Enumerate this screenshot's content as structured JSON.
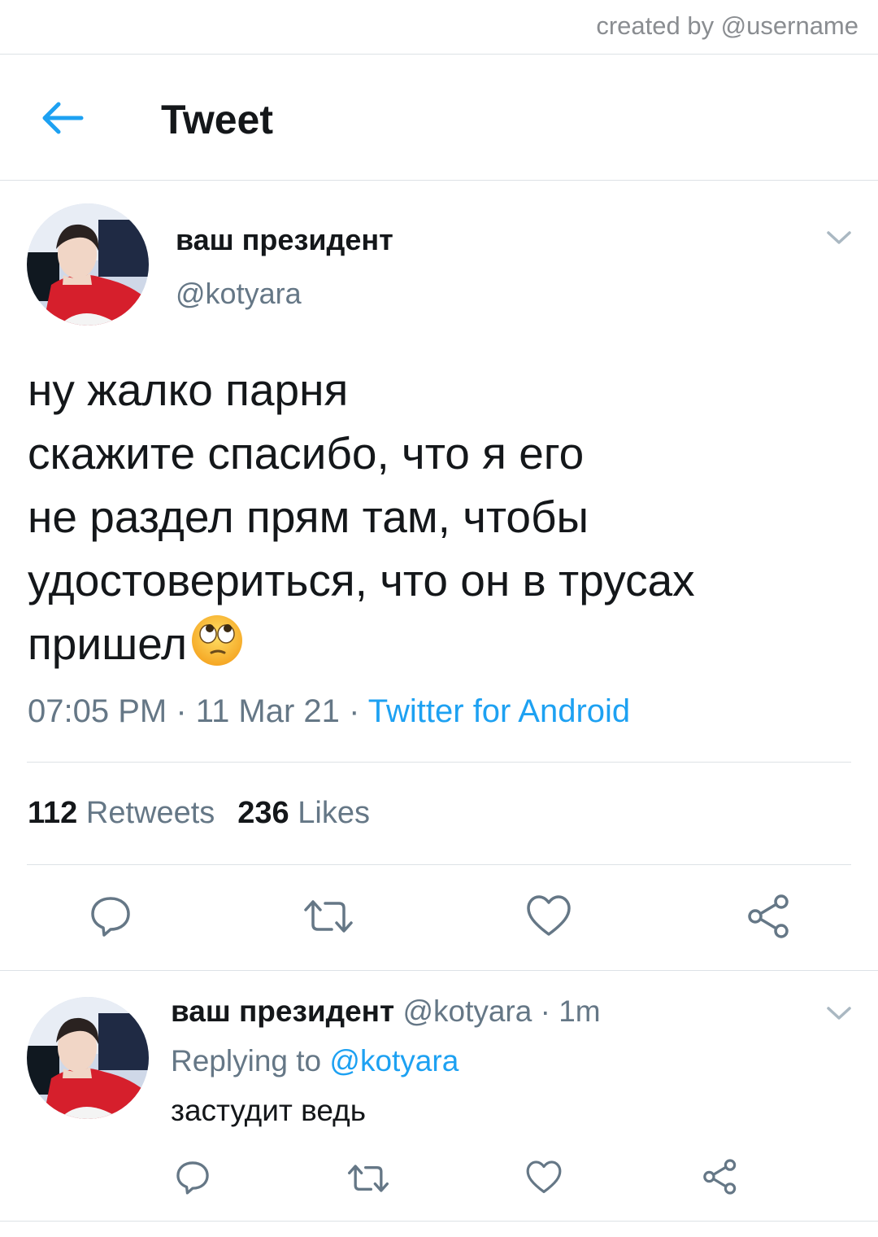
{
  "watermark": "created by @username",
  "header": {
    "title": "Tweet",
    "back_icon": "arrow-left-icon"
  },
  "tweet": {
    "author_name": "ваш президент",
    "author_handle": "@kotyara",
    "text_lines": [
      "ну жалко парня",
      "скажите спасибо, что я его",
      "не раздел прям там, чтобы",
      "удостовериться, что он в трусах",
      "пришел"
    ],
    "emoji": "face-with-rolling-eyes",
    "time": "07:05 PM",
    "date": "11 Mar 21",
    "separator": "·",
    "source": "Twitter for Android",
    "retweets_count": "112",
    "retweets_label": "Retweets",
    "likes_count": "236",
    "likes_label": "Likes"
  },
  "reply": {
    "author_name": "ваш президент",
    "author_handle": "@kotyara",
    "time_ago": "· 1m",
    "replying_prefix": "Replying to",
    "replying_to": "@kotyara",
    "text": "застудит ведь"
  },
  "colors": {
    "accent": "#1da1f2",
    "secondary_text": "#657786",
    "divider": "#dde2e6",
    "icon": "#657786"
  }
}
